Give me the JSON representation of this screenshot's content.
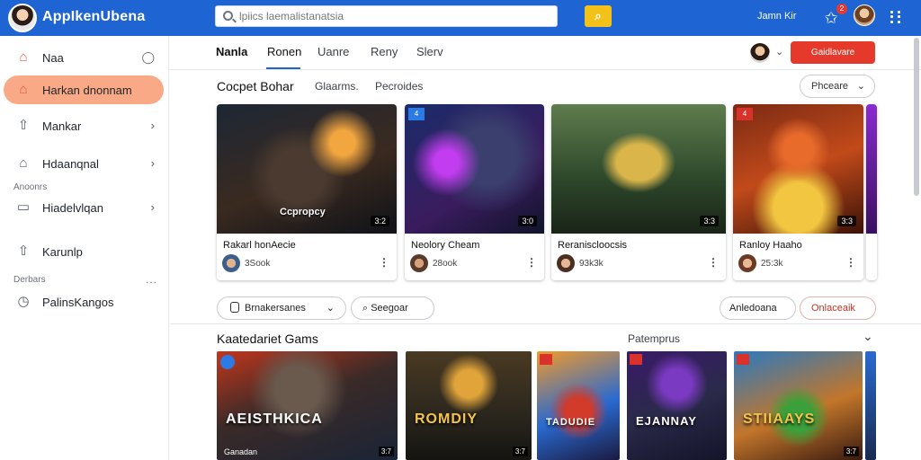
{
  "header": {
    "app_title": "AppIkenUbena",
    "search_placeholder": "lpiics laemalistanatsia",
    "yellow_button_icon": "search-icon",
    "user_name": "Jamn Kir",
    "notification_count": "2",
    "accent_color": "#1e64d2"
  },
  "sidebar": {
    "items": [
      {
        "label": "Naa",
        "icon": "home-icon",
        "right_icon": "chat-icon"
      },
      {
        "label": "Harkan dnonnam",
        "icon": "home-icon",
        "active": true
      },
      {
        "label": "Mankar",
        "icon": "share-icon",
        "right_icon": "chevron-right-icon"
      },
      {
        "label": "Hdaanqnal",
        "icon": "home-icon",
        "right_icon": "chevron-right-icon"
      },
      {
        "label": "Hiadelvlqan",
        "icon": "bookmark-icon",
        "right_icon": "chevron-right-icon"
      },
      {
        "label": "Karunlp",
        "icon": "share-icon"
      },
      {
        "label": "PalinsKangos",
        "icon": "clock-icon"
      }
    ],
    "section_1": "Anoonrs",
    "section_2": "Derbars",
    "section_more": "..."
  },
  "tabs": [
    "Nanla",
    "Ronen",
    "Uanre",
    "Reny",
    "Slerv"
  ],
  "create_button": "Gaidlavare",
  "row1": {
    "title": "Cocpet Bohar",
    "subtitle_1": "Glaarms.",
    "subtitle_2": "Pecroides",
    "filter_label": "Phceare",
    "cards": [
      {
        "title": "Rakarl honAecie",
        "views": "3Sook",
        "duration": "3:2",
        "img_label": "Ccpropcy",
        "badge": ""
      },
      {
        "title": "Neolory Cheam",
        "views": "28ook",
        "duration": "3:0",
        "img_label": "",
        "badge": "4"
      },
      {
        "title": "Reraniscloocsis",
        "views": "93k3k",
        "duration": "3:3",
        "img_label": "",
        "badge": ""
      },
      {
        "title": "Ranloy Haaho",
        "views": "25:3k",
        "duration": "3:3",
        "img_label": "",
        "badge": "4"
      }
    ]
  },
  "filters": {
    "pill_1": "Brnakersanes",
    "pill_2": "Seegoar",
    "pill_3": "Anledoana",
    "pill_4": "Onlaceaik"
  },
  "row2": {
    "title": "Kaatedariet Gams",
    "right_label": "Patemprus",
    "tiles": [
      {
        "label": "AEISTHKICA",
        "duration": "3:7",
        "play": "Ganadan"
      },
      {
        "label": "ROMDIY",
        "duration": "3:7",
        "play": ""
      },
      {
        "label": "TADUDIE",
        "duration": "",
        "play": ""
      },
      {
        "label": "EJANNAY",
        "duration": "",
        "play": ""
      },
      {
        "label": "STIIAAYS",
        "duration": "3:7",
        "play": ""
      }
    ]
  },
  "colors": {
    "active_pill": "#f9a986",
    "red": "#e53a2b"
  }
}
